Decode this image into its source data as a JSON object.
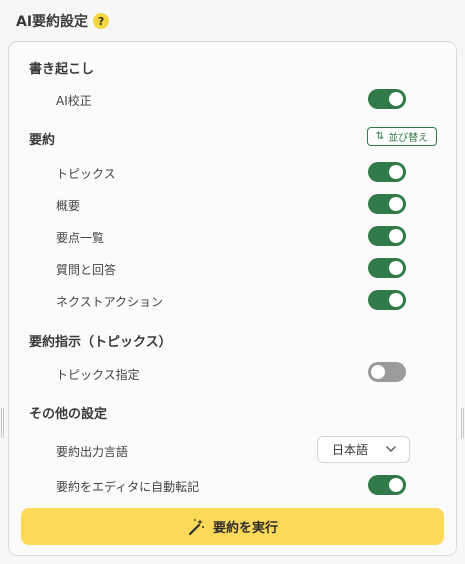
{
  "header": {
    "title": "AI要約設定",
    "help_icon": "help-icon",
    "help_glyph": "?"
  },
  "transcription": {
    "title": "書き起こし",
    "items": [
      {
        "label": "AI校正",
        "enabled": true
      }
    ]
  },
  "summary": {
    "title": "要約",
    "sort_button": {
      "label": "並び替え",
      "icon": "sort-icon",
      "glyph": "⇅"
    },
    "items": [
      {
        "label": "トピックス",
        "enabled": true
      },
      {
        "label": "概要",
        "enabled": true
      },
      {
        "label": "要点一覧",
        "enabled": true
      },
      {
        "label": "質問と回答",
        "enabled": true
      },
      {
        "label": "ネクストアクション",
        "enabled": true
      }
    ]
  },
  "instructions": {
    "title": "要約指示（トピックス）",
    "items": [
      {
        "label": "トピックス指定",
        "enabled": false
      }
    ]
  },
  "other": {
    "title": "その他の設定",
    "language": {
      "label": "要約出力言語",
      "value": "日本語"
    },
    "auto_transfer": {
      "label": "要約をエディタに自動転記",
      "enabled": true
    }
  },
  "run_button": {
    "label": "要約を実行",
    "icon": "magic-wand-icon"
  },
  "colors": {
    "toggle_on": "#2f7a48",
    "toggle_off": "#9b9b9b",
    "run_button": "#fdd95a",
    "help_badge": "#f2d640"
  }
}
